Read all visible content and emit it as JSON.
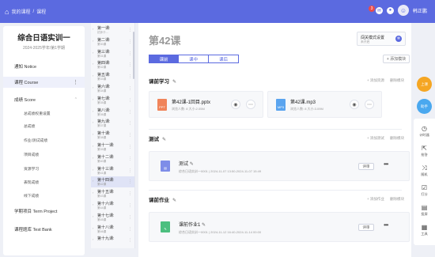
{
  "topbar": {
    "home_glyph": "⌂",
    "breadcrumb": [
      "我的课程",
      "课程"
    ],
    "user_name": "韩正鹏",
    "notif_count": "3"
  },
  "sidebar": {
    "course_title": "综合日语实训一",
    "course_subtitle": "2024-2025学年/第1学期",
    "items": [
      {
        "label": "通知 Notice"
      },
      {
        "label": "课程 Course"
      },
      {
        "label": "成绩 Score"
      }
    ],
    "score_sub": [
      "总成绩权重设置",
      "总成绩",
      "作业/测试成绩",
      "项目成绩",
      "资源学习",
      "表现成绩",
      "线下成绩"
    ],
    "bottom_items": [
      {
        "label": "学期项目 Term Project"
      },
      {
        "label": "课程题库 Test Bank"
      }
    ]
  },
  "lessons": [
    {
      "name": "第一课:",
      "sub": "初步介..."
    },
    {
      "name": "第二课:",
      "sub": "第30课"
    },
    {
      "name": "第三课:",
      "sub": "第31课"
    },
    {
      "name": "第四课:",
      "sub": "第32课"
    },
    {
      "name": "第五课:",
      "sub": "第33课"
    },
    {
      "name": "第六课:",
      "sub": "第34课"
    },
    {
      "name": "第七课:",
      "sub": "第35课"
    },
    {
      "name": "第八课:",
      "sub": "第36课"
    },
    {
      "name": "第九课:",
      "sub": "第37课"
    },
    {
      "name": "第十课:",
      "sub": "第38课"
    },
    {
      "name": "第十一课:",
      "sub": "第39课"
    },
    {
      "name": "第十二课:",
      "sub": "第40课"
    },
    {
      "name": "第十三课:",
      "sub": "第41课"
    },
    {
      "name": "第十四课:",
      "sub": "第42课"
    },
    {
      "name": "第十五课:",
      "sub": "第43课"
    },
    {
      "name": "第十六课:",
      "sub": "第44课"
    },
    {
      "name": "第十七课:",
      "sub": "第45课"
    },
    {
      "name": "第十八课:",
      "sub": "第46课"
    },
    {
      "name": "第十九课:",
      "sub": ""
    }
  ],
  "active_lesson_index": 13,
  "main": {
    "title": "第42课",
    "mode": {
      "label": "闯关模式设置",
      "sub": "未开启"
    },
    "tabs": [
      "课前",
      "课中",
      "课后"
    ],
    "active_tab": 0,
    "add_module": "+ 添加模块",
    "sections": {
      "pre_study": {
        "title": "课前学习",
        "actions": [
          "+ 添加资源",
          "删除模块"
        ],
        "files": [
          {
            "name": "第42课-1回目.pptx",
            "meta": "浏览人数: 8   大小:2.05M",
            "ext": "PPT"
          },
          {
            "name": "第42课.mp3",
            "meta": "浏览人数: 8   大小:3.09M",
            "ext": "MP3"
          }
        ]
      },
      "test": {
        "title": "测试",
        "actions": [
          "+ 添加测试",
          "删除模块"
        ],
        "item": {
          "name": "测试",
          "meta": "综合日语实训一0001 | 2024-11-07 13:50-2024-11-07 15:49",
          "action": "评审"
        }
      },
      "homework": {
        "title": "课前作业",
        "actions": [
          "+ 添加作业",
          "删除模块"
        ],
        "item": {
          "name": "课前作业1",
          "meta": "综合日语实训一0001 | 2024-11-12 16:40-2024-11-14 00:00",
          "action": "评审"
        }
      }
    }
  },
  "floating": {
    "btn1": "上课",
    "btn2": "助手"
  },
  "tools": [
    {
      "icon": "◷",
      "label": "计时器"
    },
    {
      "icon": "⇱",
      "label": "抢答"
    },
    {
      "icon": "⤨",
      "label": "随机"
    },
    {
      "icon": "☑",
      "label": "打分"
    },
    {
      "icon": "▤",
      "label": "投屏"
    },
    {
      "icon": "▦",
      "label": "工具"
    }
  ],
  "colors": {
    "accent": "#5b6ae0",
    "orange": "#f5a623",
    "blue": "#4aa8ef"
  }
}
